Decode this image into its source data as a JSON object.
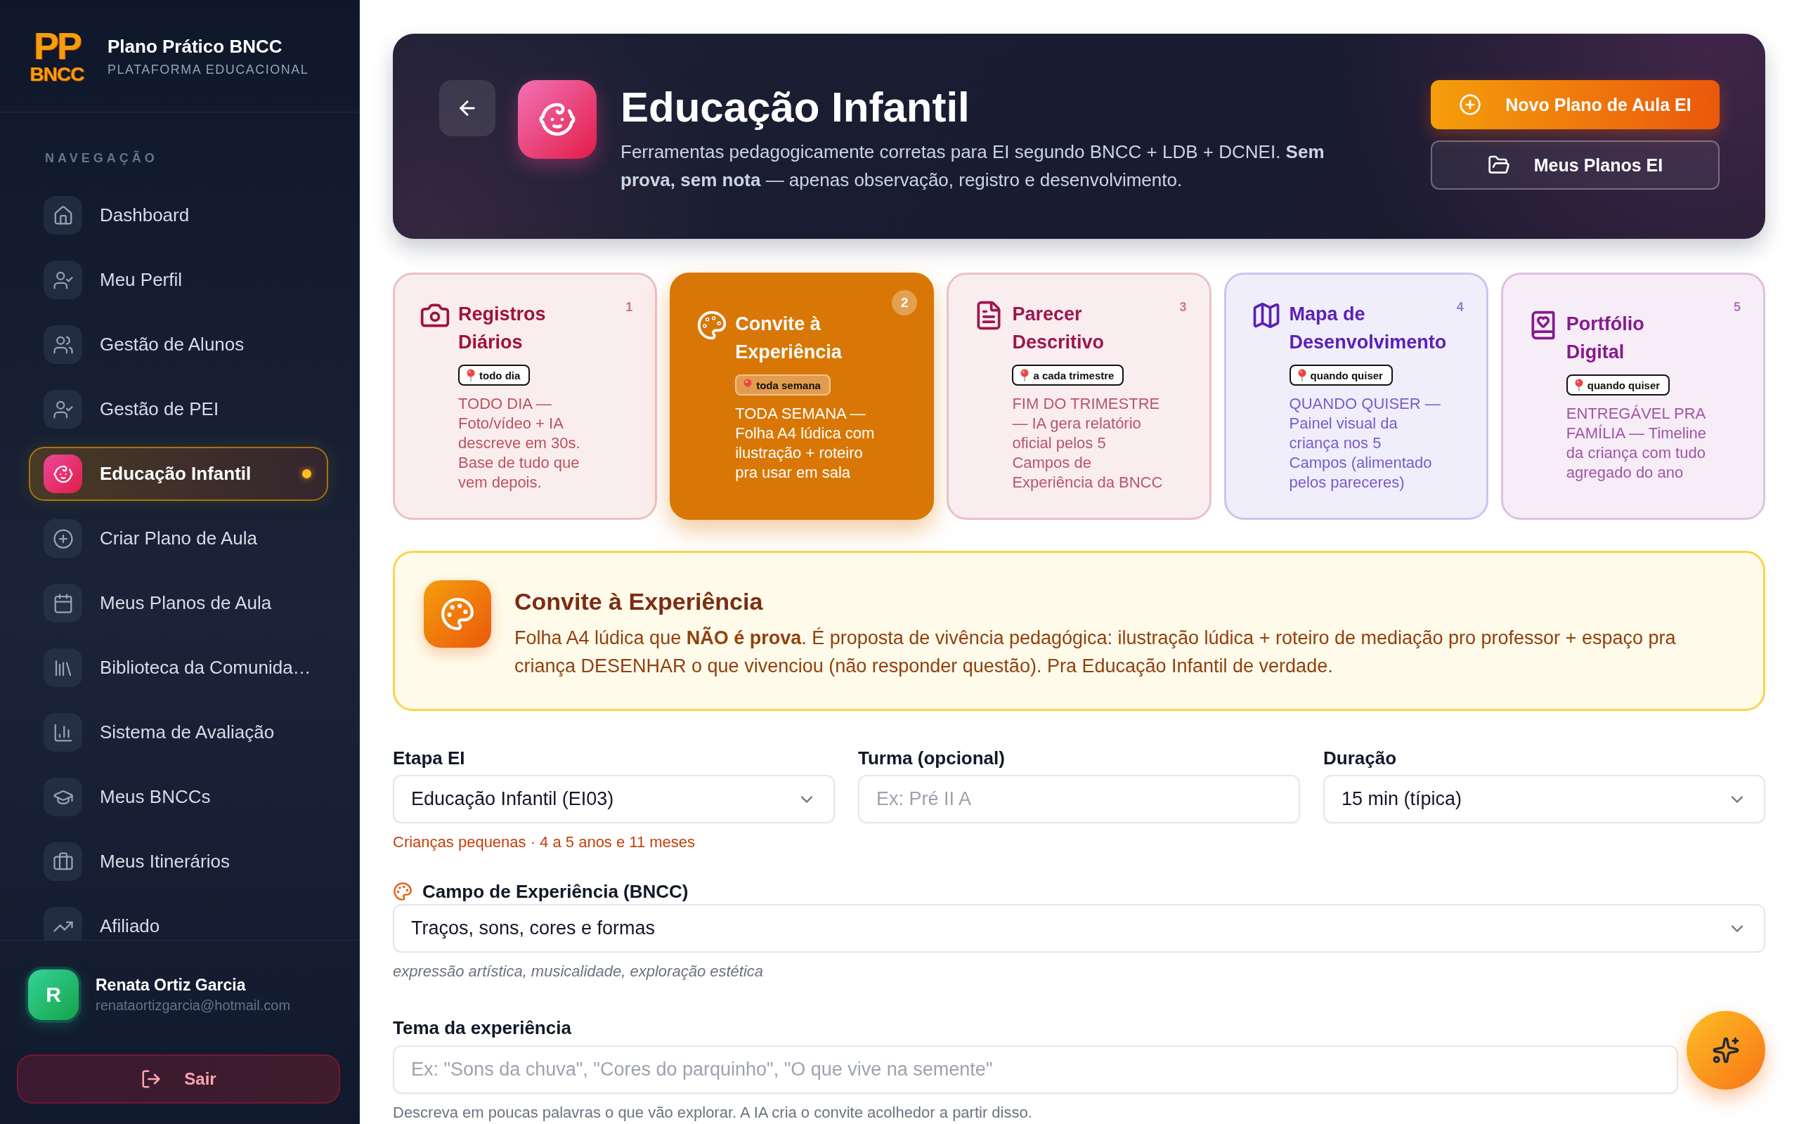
{
  "sidebar": {
    "logo": {
      "top": "PP",
      "bottom": "BNCC"
    },
    "brand_title": "Plano Prático BNCC",
    "brand_subtitle": "PLATAFORMA EDUCACIONAL",
    "section_label": "NAVEGAÇÃO",
    "nav_items": [
      {
        "kind": "home",
        "label": "Dashboard",
        "selected": false
      },
      {
        "kind": "user-check",
        "label": "Meu Perfil",
        "selected": false
      },
      {
        "kind": "users",
        "label": "Gestão de Alunos",
        "selected": false
      },
      {
        "kind": "user-check",
        "label": "Gestão de PEI",
        "selected": false
      },
      {
        "kind": "baby",
        "label": "Educação Infantil",
        "selected": true
      },
      {
        "kind": "plus-circle",
        "label": "Criar Plano de Aula",
        "selected": false
      },
      {
        "kind": "calendar",
        "label": "Meus Planos de Aula",
        "selected": false
      },
      {
        "kind": "library",
        "label": "Biblioteca da Comunida…",
        "selected": false
      },
      {
        "kind": "chart",
        "label": "Sistema de Avaliação",
        "selected": false
      },
      {
        "kind": "graduation-cap",
        "label": "Meus BNCCs",
        "selected": false
      },
      {
        "kind": "briefcase",
        "label": "Meus Itinerários",
        "selected": false
      },
      {
        "kind": "trend-up",
        "label": "Afiliado",
        "selected": false
      }
    ],
    "user": {
      "initial": "R",
      "name": "Renata Ortiz Garcia",
      "email": "renataortizgarcia@hotmail.com"
    },
    "logout_label": "Sair"
  },
  "header": {
    "title": "Educação Infantil",
    "subtitle": "Ferramentas pedagogicamente corretas para EI segundo BNCC + LDB + DCNEI. **Sem prova, sem nota** — apenas observação, registro e desenvolvimento.",
    "actions": [
      {
        "kind": "primary",
        "label": "Novo Plano de Aula EI"
      },
      {
        "kind": "secondary",
        "label": "Meus Planos EI"
      }
    ]
  },
  "tools": [
    {
      "kind": "camera",
      "number": "1",
      "title": "Registros Diários",
      "frequency": "todo dia",
      "description": "TODO DIA — Foto/vídeo + IA descreve em 30s. Base de tudo que vem depois.",
      "color": "#9f1239",
      "selected": false
    },
    {
      "kind": "palette",
      "number": "2",
      "title": "Convite à Experiência",
      "frequency": "toda semana",
      "description": "TODA SEMANA — Folha A4 lúdica com ilustração + roteiro pra usar em sala",
      "color": "#d97706",
      "selected": true
    },
    {
      "kind": "document",
      "number": "3",
      "title": "Parecer Descritivo",
      "frequency": "a cada trimestre",
      "description": "FIM DO TRIMESTRE — IA gera relatório oficial pelos 5 Campos de Experiência da BNCC",
      "color": "#9d174d",
      "selected": false
    },
    {
      "kind": "map",
      "number": "4",
      "title": "Mapa de Desenvolvimento",
      "frequency": "quando quiser",
      "description": "QUANDO QUISER — Painel visual da criança nos 5 Campos (alimentado pelos pareceres)",
      "color": "#5b21b6",
      "selected": false
    },
    {
      "kind": "book-heart",
      "number": "5",
      "title": "Portfólio Digital",
      "frequency": "quando quiser",
      "description": "ENTREGÁVEL PRA FAMÍLIA — Timeline da criança com tudo agregado do ano",
      "color": "#86198f",
      "selected": false
    }
  ],
  "info": {
    "title": "Convite à Experiência",
    "text": "Folha A4 lúdica que **NÃO é prova**. É proposta de vivência pedagógica: ilustração lúdica + roteiro de mediação pro professor + espaço pra criança DESENHAR o que vivenciou (não responder questão). Pra Educação Infantil de verdade."
  },
  "form": {
    "fields": [
      {
        "kind": "select",
        "label": "Etapa EI",
        "value": "Educação Infantil (EI03)",
        "hint": "Crianças pequenas · 4 a 5 anos e 11 meses"
      },
      {
        "kind": "input",
        "label": "Turma (opcional)",
        "placeholder": "Ex: Pré II A"
      },
      {
        "kind": "select",
        "label": "Duração",
        "value": "15 min (típica)"
      }
    ],
    "campo": {
      "kind": "select",
      "label": "Campo de Experiência (BNCC)",
      "value": "Traços, sons, cores e formas",
      "hint": "expressão artística, musicalidade, exploração estética"
    },
    "tema": {
      "kind": "input",
      "label": "Tema da experiência",
      "placeholder": "Ex: \"Sons da chuva\", \"Cores do parquinho\", \"O que vive na semente\"",
      "hint": "Descreva em poucas palavras o que vão explorar. A IA cria o convite acolhedor a partir disso."
    }
  }
}
